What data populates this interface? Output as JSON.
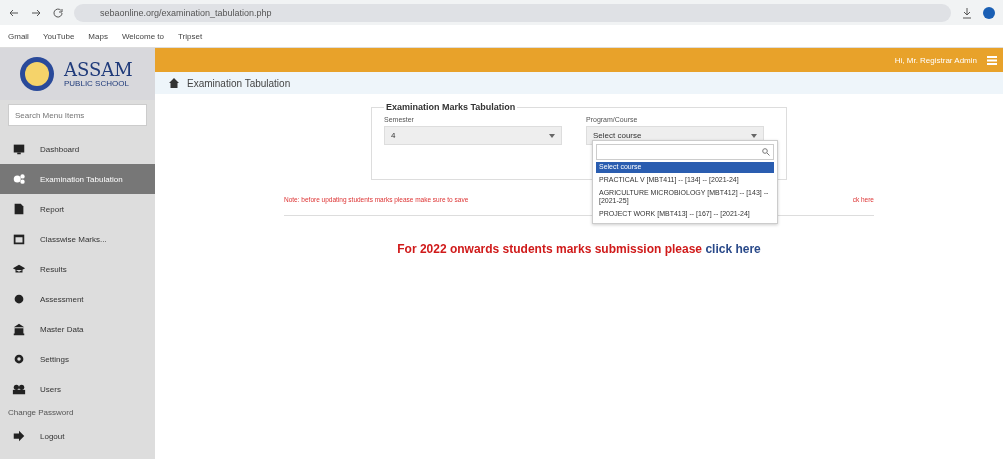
{
  "browser": {
    "url": "sebaonline.org/examination_tabulation.php",
    "bookmarks": [
      "Gmail",
      "YouTube",
      "Maps",
      "Welcome to",
      "Tripset"
    ]
  },
  "header": {
    "user": "Hi, Mr. Registrar Admin"
  },
  "sidebar": {
    "logo_text": "ASSAM",
    "logo_sub": "PUBLIC SCHOOL",
    "search": {
      "placeholder": "Search Menu Items"
    },
    "items": [
      {
        "label": "Dashboard",
        "selected": false
      },
      {
        "label": "Examination Tabulation",
        "selected": true
      },
      {
        "label": "Report",
        "selected": false
      },
      {
        "label": "Classwise Marks...",
        "selected": false
      },
      {
        "label": "Results",
        "selected": false
      },
      {
        "label": "Assessment",
        "selected": false
      },
      {
        "label": "Master Data",
        "selected": false
      },
      {
        "label": "Settings",
        "selected": false
      },
      {
        "label": "Users",
        "selected": false
      }
    ],
    "section": "Change Password",
    "footer_item": {
      "label": "Logout"
    }
  },
  "breadcrumb": "Examination Tabulation",
  "form": {
    "legend": "Examination Marks Tabulation",
    "semester": {
      "label": "Semester",
      "value": "4"
    },
    "course": {
      "label": "Program/Course",
      "value": "Select course",
      "options": [
        {
          "label": "Select course",
          "selected": true
        },
        {
          "label": "PRACTICAL V [MBT411] -- [134] -- [2021-24]",
          "selected": false
        },
        {
          "label": "AGRICULTURE MICROBIOLOGY [MBT412] -- [143] -- [2021-25]",
          "selected": false
        },
        {
          "label": "PROJECT WORK [MBT413] -- [167] -- [2021-24]",
          "selected": false
        }
      ]
    }
  },
  "note_start": "Note: before updating students marks please make sure to save",
  "note_end": "ck here",
  "notice": {
    "text": "For 2022 onwards students marks submission please",
    "link": "click here"
  }
}
